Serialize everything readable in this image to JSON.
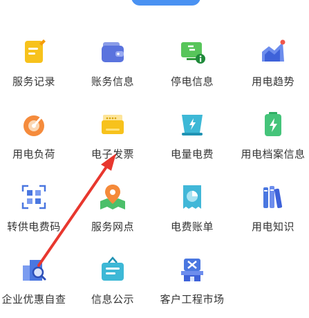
{
  "colors": {
    "accent_blue": "#4a92f2",
    "arrow_red": "#e8372e",
    "label_text": "#333333"
  },
  "grid": {
    "items": [
      {
        "label": "服务记录",
        "icon": "notepad-icon"
      },
      {
        "label": "账务信息",
        "icon": "wallet-icon"
      },
      {
        "label": "停电信息",
        "icon": "power-outage-icon"
      },
      {
        "label": "用电趋势",
        "icon": "trend-chart-icon"
      },
      {
        "label": "用电负荷",
        "icon": "gauge-icon"
      },
      {
        "label": "电子发票",
        "icon": "invoice-icon"
      },
      {
        "label": "电量电费",
        "icon": "energy-cup-icon"
      },
      {
        "label": "用电档案信息",
        "icon": "battery-file-icon"
      },
      {
        "label": "转供电费码",
        "icon": "qr-code-icon"
      },
      {
        "label": "服务网点",
        "icon": "map-pin-icon"
      },
      {
        "label": "电费账单",
        "icon": "bill-pie-icon"
      },
      {
        "label": "用电知识",
        "icon": "books-icon"
      },
      {
        "label": "企业优惠自查",
        "icon": "building-search-icon"
      },
      {
        "label": "信息公示",
        "icon": "notice-board-icon"
      },
      {
        "label": "客户工程市场",
        "icon": "tools-shop-icon"
      }
    ]
  }
}
